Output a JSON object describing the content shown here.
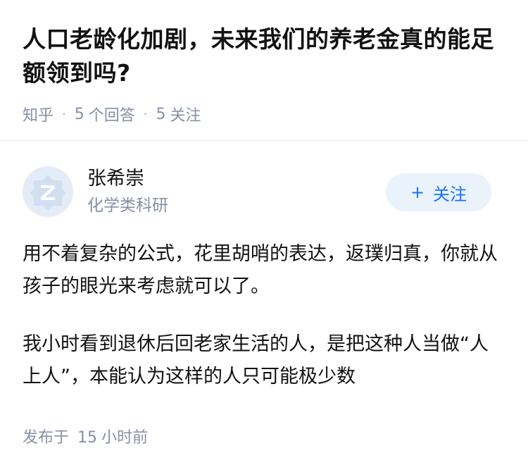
{
  "question": {
    "title": "人口老龄化加剧，未来我们的养老金真的能足额领到吗?",
    "source": "知乎",
    "answers_count": "5",
    "answers_label": "个回答",
    "followers_count": "5",
    "followers_label": "关注",
    "separator": "·"
  },
  "author": {
    "avatar_icon": "zhihu-default-avatar-icon",
    "name": "张希崇",
    "bio": "化学类科研",
    "follow_label": "关注",
    "follow_icon": "plus-icon"
  },
  "answer": {
    "paragraphs": [
      "用不着复杂的公式，花里胡哨的表达，返璞归真，你就从孩子的眼光来考虑就可以了。",
      "我小时看到退休后回老家生活的人，是把这种人当做“人上人”，本能认为这样的人只可能极少数"
    ]
  },
  "footer": {
    "published_label": "发布于",
    "published_value": "15",
    "published_unit": "小时前"
  },
  "colors": {
    "text": "#121212",
    "meta": "#8590a6",
    "accent": "#1772f6",
    "button_bg": "#eaf2fb"
  }
}
